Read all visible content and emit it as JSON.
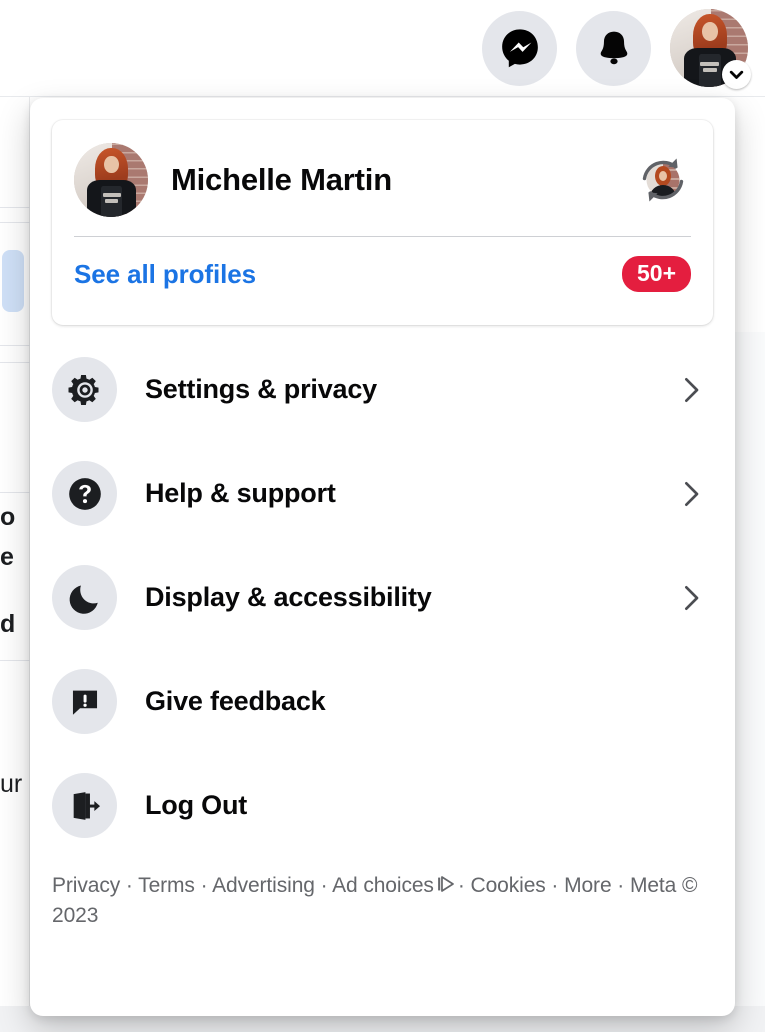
{
  "topbar": {
    "messenger_label": "Messenger",
    "messenger_icon": "messenger-icon",
    "notifications_label": "Notifications",
    "notifications_icon": "bell-icon",
    "account_label": "Account",
    "caret_icon": "chevron-down-icon"
  },
  "profile": {
    "name": "Michelle Martin",
    "avatar_icon": "profile-avatar",
    "switch_icon": "switch-profile-icon",
    "see_all_profiles": "See all profiles",
    "badge": "50+"
  },
  "menu": {
    "items": [
      {
        "label": "Settings & privacy",
        "icon": "gear-icon",
        "has_chevron": true
      },
      {
        "label": "Help & support",
        "icon": "question-circle-icon",
        "has_chevron": true
      },
      {
        "label": "Display & accessibility",
        "icon": "moon-icon",
        "has_chevron": true
      },
      {
        "label": "Give feedback",
        "icon": "feedback-icon",
        "has_chevron": false
      },
      {
        "label": "Log Out",
        "icon": "logout-icon",
        "has_chevron": false
      }
    ]
  },
  "footer": {
    "privacy": "Privacy",
    "terms": "Terms",
    "advertising": "Advertising",
    "ad_choices": "Ad choices",
    "ad_choices_icon": "adchoices-icon",
    "cookies": "Cookies",
    "more": "More",
    "meta": "Meta © 2023",
    "sep": "·"
  },
  "background": {
    "fragments": [
      "o",
      "e",
      "d",
      "ur"
    ]
  },
  "colors": {
    "brand_blue": "#1b74e4",
    "badge_red": "#e41e3f",
    "icon_bg": "#e4e6eb",
    "text_primary": "#080809",
    "text_secondary": "#65676b",
    "panel_white": "#ffffff"
  }
}
